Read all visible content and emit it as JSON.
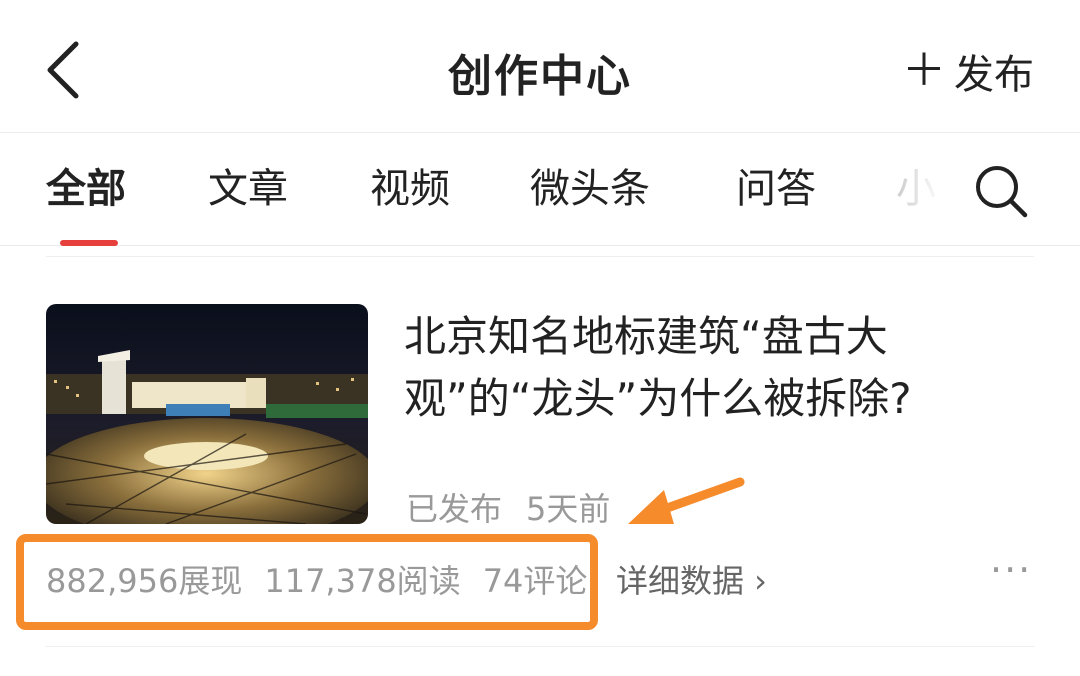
{
  "header": {
    "title": "创作中心",
    "publish_label": "发布"
  },
  "tabs": [
    {
      "label": "全部",
      "active": true
    },
    {
      "label": "文章"
    },
    {
      "label": "视频"
    },
    {
      "label": "微头条"
    },
    {
      "label": "问答"
    },
    {
      "label": "小"
    }
  ],
  "article": {
    "title": "北京知名地标建筑“盘古大观”的“龙头”为什么被拆除?",
    "status": "已发布",
    "time": "5天前",
    "impressions": "882,956展现",
    "reads": "117,378阅读",
    "comments": "74评论",
    "detail_label": "详细数据 ›",
    "more": "···"
  },
  "colors": {
    "accent": "#e5403c",
    "highlight": "#f68b2c",
    "muted": "#999999"
  },
  "icons": [
    "back-icon",
    "plus-icon",
    "search-icon",
    "more-icon",
    "arrow-annotation"
  ]
}
